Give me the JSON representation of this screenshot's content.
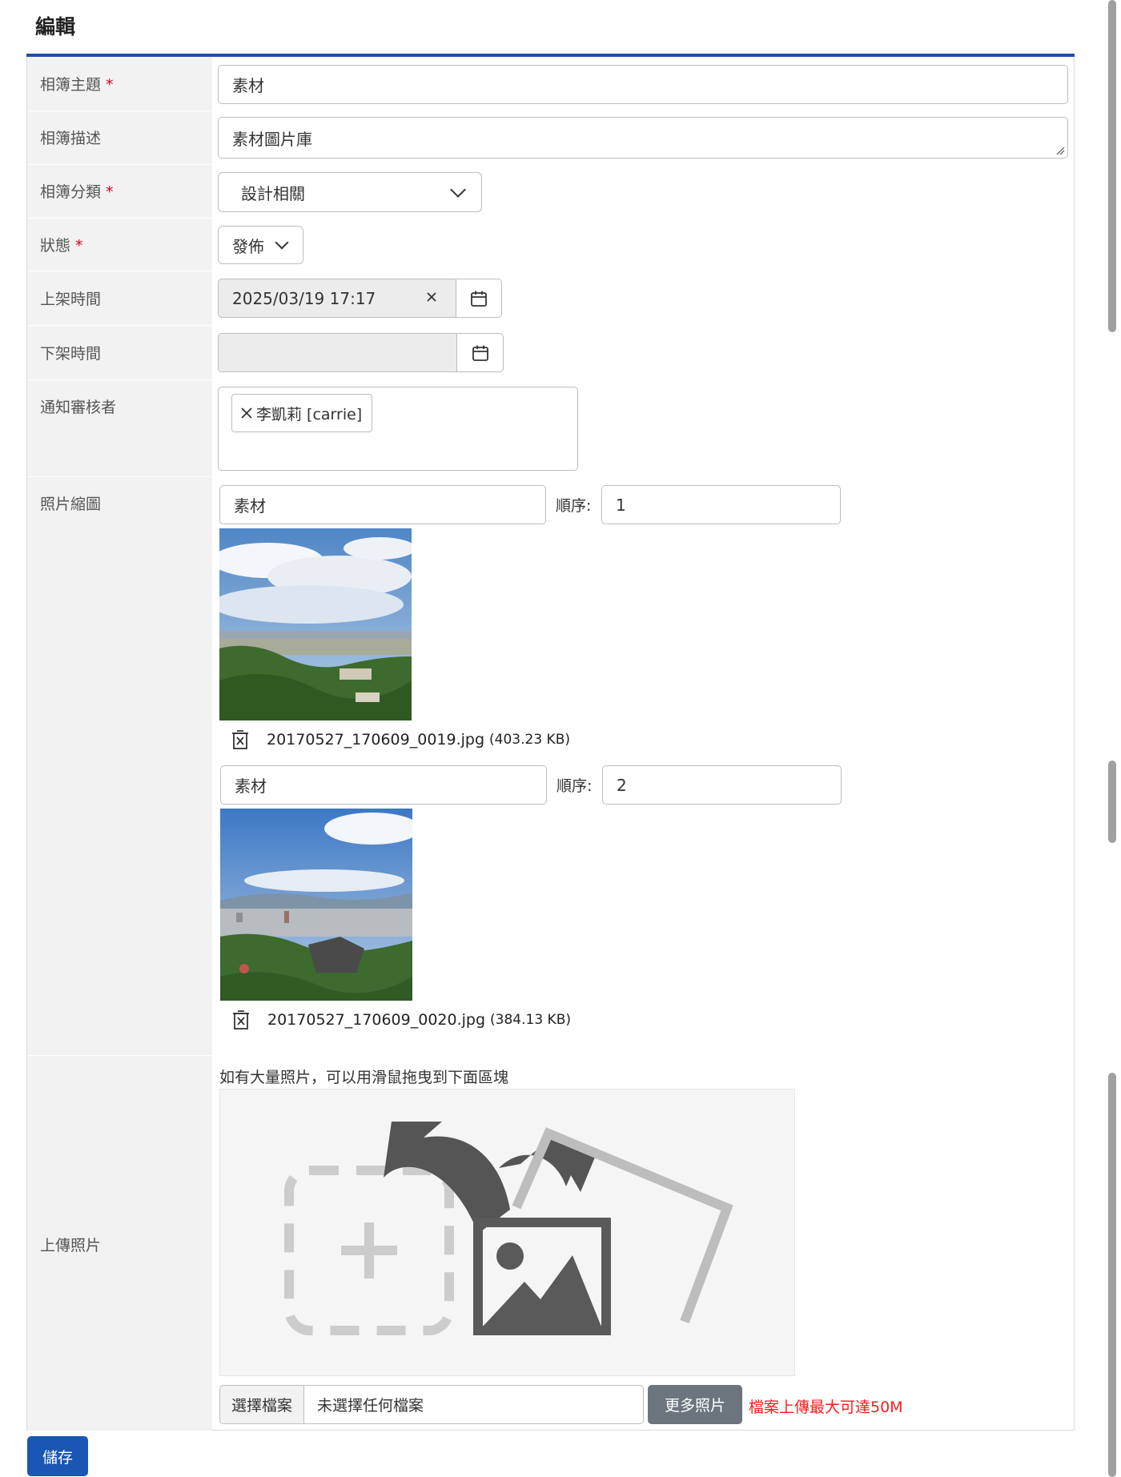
{
  "page": {
    "title": "編輯"
  },
  "form": {
    "album_title": {
      "label": "相簿主題",
      "required_mark": "*",
      "value": "素材"
    },
    "album_description": {
      "label": "相簿描述",
      "value": "素材圖片庫"
    },
    "album_category": {
      "label": "相簿分類",
      "required_mark": "*",
      "selected": "設計相關"
    },
    "status": {
      "label": "狀態",
      "required_mark": "*",
      "selected": "發佈"
    },
    "publish_time": {
      "label": "上架時間",
      "value": "2025/03/19 17:17"
    },
    "unpublish_time": {
      "label": "下架時間",
      "value": ""
    },
    "notify_reviewer": {
      "label": "通知審核者",
      "tags": [
        "李凱莉 [carrie]"
      ]
    },
    "photos": {
      "label": "照片縮圖",
      "order_label": "順序:",
      "items": [
        {
          "caption": "素材",
          "order": "1",
          "filename": "20170527_170609_0019.jpg",
          "size": "(403.23 KB)"
        },
        {
          "caption": "素材",
          "order": "2",
          "filename": "20170527_170609_0020.jpg",
          "size": "(384.13 KB)"
        }
      ]
    },
    "upload": {
      "label": "上傳照片",
      "hint": "如有大量照片，可以用滑鼠拖曳到下面區塊",
      "choose_file_label": "選擇檔案",
      "no_file_text": "未選擇任何檔案",
      "more_photos_label": "更多照片",
      "max_size_note": "檔案上傳最大可達50M"
    }
  },
  "actions": {
    "save_label": "儲存"
  },
  "colors": {
    "accent_rule": "#1f4ea8",
    "primary_button": "#1a56b3",
    "secondary_button": "#6c757d",
    "required": "#d9001b",
    "warning": "#ff1a1a"
  }
}
